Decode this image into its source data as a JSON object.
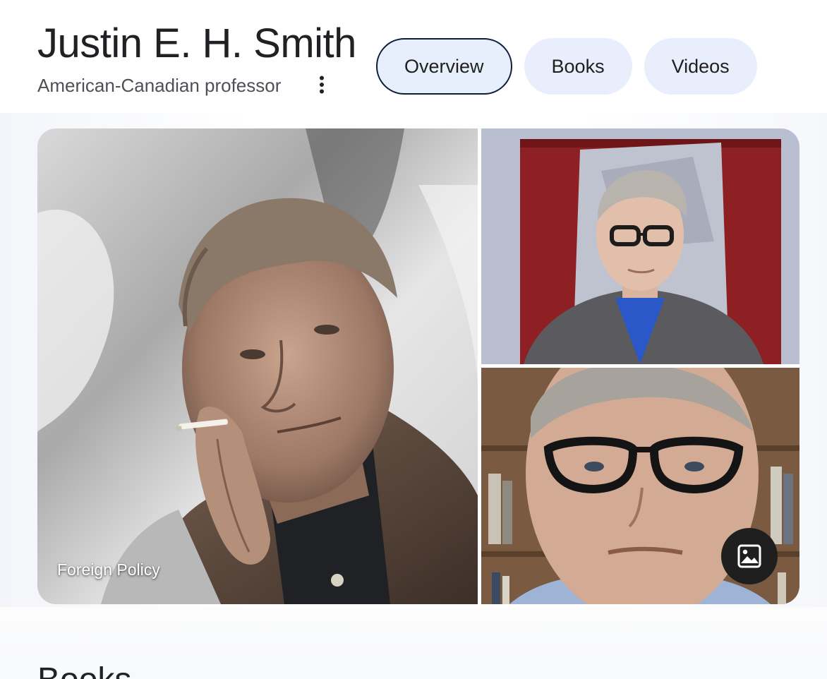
{
  "header": {
    "title": "Justin E. H. Smith",
    "subtitle": "American-Canadian professor",
    "more_icon": "more-vert-icon"
  },
  "tabs": [
    {
      "label": "Overview",
      "active": true
    },
    {
      "label": "Books",
      "active": false
    },
    {
      "label": "Videos",
      "active": false
    }
  ],
  "gallery": {
    "main_caption": "Foreign Policy",
    "images_button_icon": "image-icon"
  },
  "next_section": {
    "heading": "Books"
  },
  "colors": {
    "tab_bg": "#e8eefb",
    "tab_active_border": "#0b1d3a",
    "title_text": "#202124",
    "subtitle_text": "#4d5156",
    "image_button_bg": "#1f1f1f"
  }
}
